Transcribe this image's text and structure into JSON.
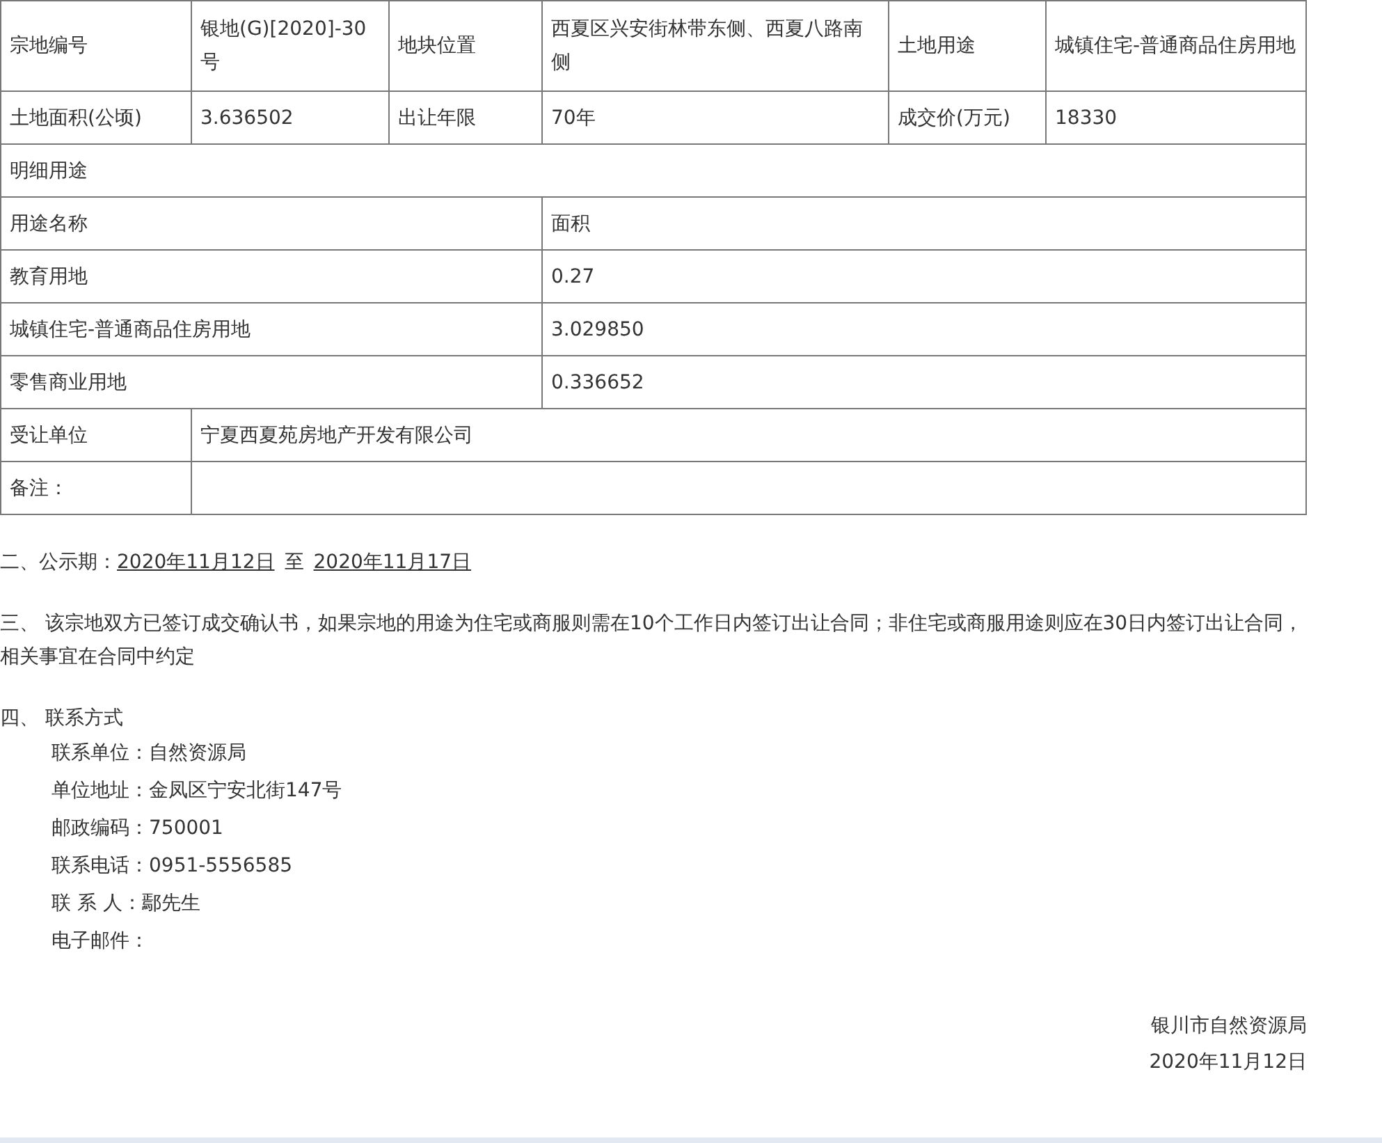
{
  "land_table": {
    "main_rows": [
      {
        "cells": [
          "宗地编号",
          "银地(G)[2020]-30号",
          "地块位置",
          "西夏区兴安街林带东侧、西夏八路南侧",
          "土地用途",
          "城镇住宅-普通商品住房用地"
        ]
      },
      {
        "cells": [
          "土地面积(公顷)",
          "3.636502",
          "出让年限",
          "70年",
          "成交价(万元)",
          "18330"
        ]
      }
    ],
    "section_title": "明细用途",
    "detail_header": [
      "用途名称",
      "面积"
    ],
    "detail_rows": [
      {
        "name": "教育用地",
        "area": "0.27"
      },
      {
        "name": "城镇住宅-普通商品住房用地",
        "area": "3.029850"
      },
      {
        "name": "零售商业用地",
        "area": "0.336652"
      }
    ],
    "transferee": {
      "label": "受让单位",
      "value": "宁夏西夏苑房地产开发有限公司"
    },
    "remarks": {
      "label": "备注："
    }
  },
  "publicity": {
    "label": "二、公示期：",
    "start": "2020年11月12日",
    "separator": "至",
    "end": "2020年11月17日"
  },
  "clause_three": "三、  该宗地双方已签订成交确认书，如果宗地的用途为住宅或商服则需在10个工作日内签订出让合同；非住宅或商服用途则应在30日内签订出让合同，相关事宜在合同中约定",
  "contact": {
    "heading": "四、  联系方式",
    "lines": [
      {
        "label": "联系单位：",
        "value": "自然资源局"
      },
      {
        "label": "单位地址：",
        "value": "金凤区宁安北街147号"
      },
      {
        "label": "邮政编码：",
        "value": "750001"
      },
      {
        "label": "联系电话：",
        "value": "0951-5556585"
      },
      {
        "label": "联 系 人：",
        "value": "鄢先生"
      },
      {
        "label": "电子邮件："
      }
    ]
  },
  "signature": {
    "issuer": "银川市自然资源局",
    "date": "2020年11月12日"
  }
}
